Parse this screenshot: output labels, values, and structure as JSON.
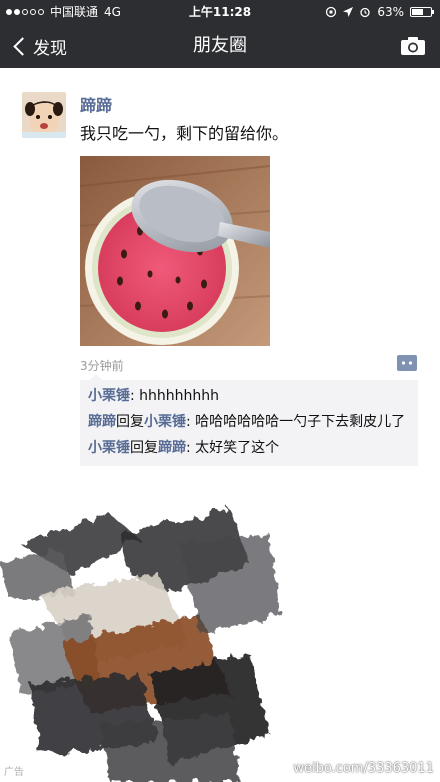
{
  "status_bar": {
    "carrier": "中国联通",
    "network": "4G",
    "time": "上午11:28",
    "battery": "63%",
    "battery_level": 0.63
  },
  "nav": {
    "back_label": "发现",
    "title": "朋友圈"
  },
  "post": {
    "author": "蹄蹄",
    "text": "我只吃一勺，剩下的留给你。",
    "time": "3分钟前",
    "comments": [
      {
        "name": "小栗锤",
        "sep": ": ",
        "text": "hhhhhhhhh"
      },
      {
        "name": "蹄蹄",
        "reply_word": "回复",
        "to": "小栗锤",
        "sep": ": ",
        "text": "哈哈哈哈哈哈一勺子下去剩皮儿了"
      },
      {
        "name": "小栗锤",
        "reply_word": "回复",
        "to": "蹄蹄",
        "sep": ": ",
        "text": "太好笑了这个"
      }
    ]
  },
  "watermark": {
    "left": "广告",
    "right": "weibo.com/33363011"
  },
  "colors": {
    "header_bg": "#2d2e32",
    "name_link": "#576b95",
    "comment_bg": "#f3f3f5"
  },
  "icons": {
    "back": "chevron-left-icon",
    "camera": "camera-icon",
    "comment": "comment-bubble-icon"
  }
}
